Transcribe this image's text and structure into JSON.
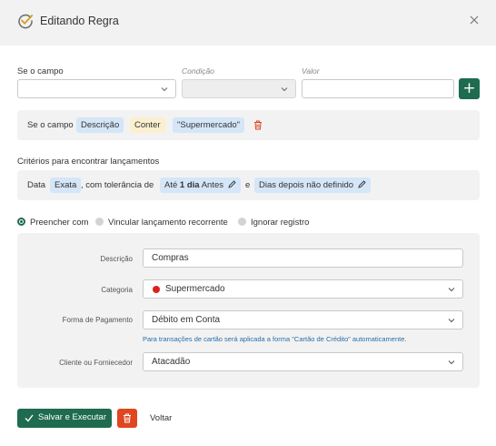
{
  "header": {
    "title": "Editando Regra",
    "check_icon": "check-circle-icon",
    "close_icon": "close-icon"
  },
  "condition_row": {
    "field_label": "Se o campo",
    "condition_label": "Condição",
    "value_label": "Valor",
    "field_value": "",
    "condition_value": "",
    "value_value": "",
    "add_label": "+"
  },
  "rule": {
    "prefix": "Se o campo",
    "field": "Descrição",
    "condition": "Conter",
    "value": "\"Supermercado\""
  },
  "criteria": {
    "title": "Critérios para encontrar lançamentos",
    "date_label": "Data",
    "date_mode": "Exata",
    "tolerance_text": ", com tolerância de",
    "before_prefix": "Até",
    "before_bold": "1 dia",
    "before_suffix": "Antes",
    "joiner": "e",
    "after_text": "Dias depois não definido"
  },
  "modes": [
    {
      "label": "Preencher com",
      "selected": true
    },
    {
      "label": "Vincular lançamento recorrente",
      "selected": false
    },
    {
      "label": "Ignorar registro",
      "selected": false
    }
  ],
  "fill": {
    "description_label": "Descrição",
    "description_value": "Compras",
    "category_label": "Categoria",
    "category_value": "Supermercado",
    "category_color": "#d9241c",
    "payment_label": "Forma de Pagamento",
    "payment_value": "Débito em Conta",
    "payment_hint": "Para transações de cartão será aplicada a forma \"Cartão de Crédito\" automaticamente.",
    "client_label": "Cliente ou Forniecedor",
    "client_value": "Atacadão"
  },
  "footer": {
    "save_label": "Salvar e Executar",
    "back_label": "Voltar"
  },
  "colors": {
    "primary": "#1f6b4f",
    "danger": "#e0461f",
    "chip_blue": "#d4e6f8",
    "chip_yellow": "#fbefcf",
    "panel": "#f2f2f2"
  }
}
